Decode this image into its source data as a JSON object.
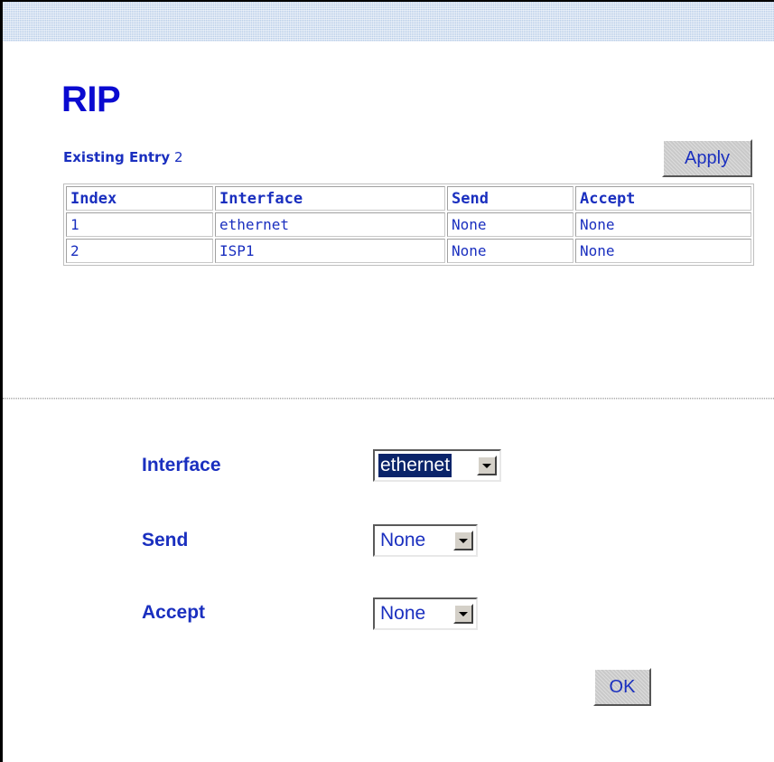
{
  "page": {
    "title": "RIP",
    "existing_entry_label": "Existing Entry",
    "existing_entry_count": "2",
    "apply_label": "Apply"
  },
  "table": {
    "headers": [
      "Index",
      "Interface",
      "Send",
      "Accept"
    ],
    "rows": [
      [
        "1",
        "ethernet",
        "None",
        "None"
      ],
      [
        "2",
        "ISP1",
        "None",
        "None"
      ]
    ]
  },
  "form": {
    "interface_label": "Interface",
    "interface_value": "ethernet",
    "send_label": "Send",
    "send_value": "None",
    "accept_label": "Accept",
    "accept_value": "None",
    "ok_label": "OK"
  },
  "colors": {
    "title": "#0a0ad0",
    "text": "#1a2fbf",
    "selection": "#0a246a"
  },
  "icons": {
    "dropdown": "chevron-down-icon"
  }
}
